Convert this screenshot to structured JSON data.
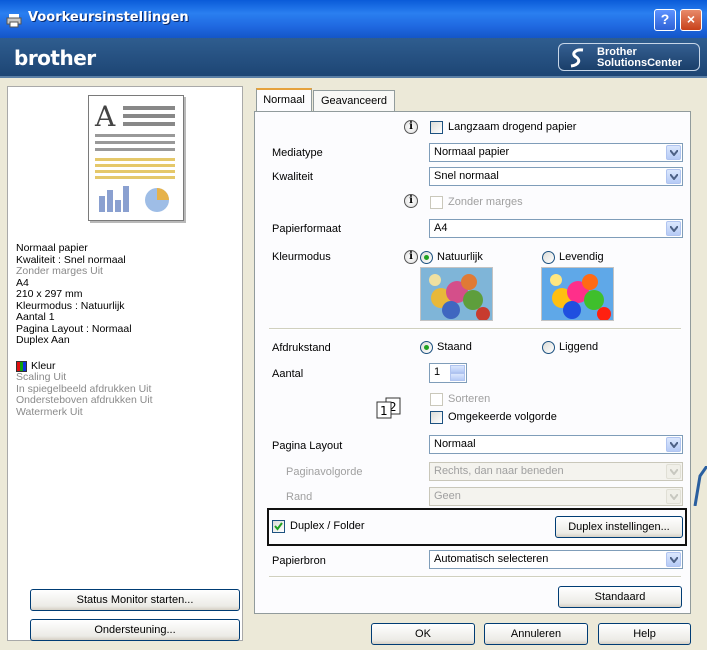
{
  "window": {
    "title": "Voorkeursinstellingen",
    "help": "?",
    "close": "×"
  },
  "brand": {
    "logo": "brother",
    "solutions_line1": "Brother",
    "solutions_line2": "SolutionsCenter"
  },
  "summary": {
    "lines": [
      {
        "text": "Normaal papier",
        "dim": false
      },
      {
        "text": "Kwaliteit : Snel normaal",
        "dim": false
      },
      {
        "text": "Zonder marges Uit",
        "dim": true
      },
      {
        "text": "A4",
        "dim": false
      },
      {
        "text": "210 x 297 mm",
        "dim": false
      },
      {
        "text": "Kleurmodus : Natuurlijk",
        "dim": false
      },
      {
        "text": "Aantal 1",
        "dim": false
      },
      {
        "text": "Pagina Layout : Normaal",
        "dim": false
      },
      {
        "text": "Duplex Aan",
        "dim": false
      }
    ],
    "color_label": "Kleur",
    "lines2": [
      "Scaling Uit",
      "In spiegelbeeld afdrukken Uit",
      "Ondersteboven afdrukken Uit",
      "Watermerk Uit"
    ]
  },
  "left_buttons": {
    "status_monitor": "Status Monitor starten...",
    "support": "Ondersteuning..."
  },
  "tabs": [
    {
      "label": "Normaal"
    },
    {
      "label": "Geavanceerd"
    }
  ],
  "normaal": {
    "slow_dry_label": "Langzaam drogend papier",
    "mediatype": {
      "label": "Mediatype",
      "value": "Normaal papier"
    },
    "kwaliteit": {
      "label": "Kwaliteit",
      "value": "Snel normaal"
    },
    "borderless_label": "Zonder marges",
    "papierformaat": {
      "label": "Papierformaat",
      "value": "A4"
    },
    "kleurmodus": {
      "label": "Kleurmodus",
      "opt1": "Natuurlijk",
      "opt2": "Levendig"
    },
    "afdrukstand": {
      "label": "Afdrukstand",
      "opt1": "Staand",
      "opt2": "Liggend"
    },
    "aantal": {
      "label": "Aantal",
      "value": "1"
    },
    "sorteren_label": "Sorteren",
    "reverse_label": "Omgekeerde volgorde",
    "pagina_layout": {
      "label": "Pagina Layout",
      "value": "Normaal"
    },
    "paginavolgorde": {
      "label": "Paginavolgorde",
      "value": "Rechts, dan naar beneden"
    },
    "rand": {
      "label": "Rand",
      "value": "Geen"
    },
    "duplex_label": "Duplex / Folder",
    "duplex_button": "Duplex instellingen...",
    "papierbron": {
      "label": "Papierbron",
      "value": "Automatisch selecteren"
    },
    "standaard_button": "Standaard"
  },
  "footer": {
    "ok": "OK",
    "cancel": "Annuleren",
    "help": "Help"
  }
}
